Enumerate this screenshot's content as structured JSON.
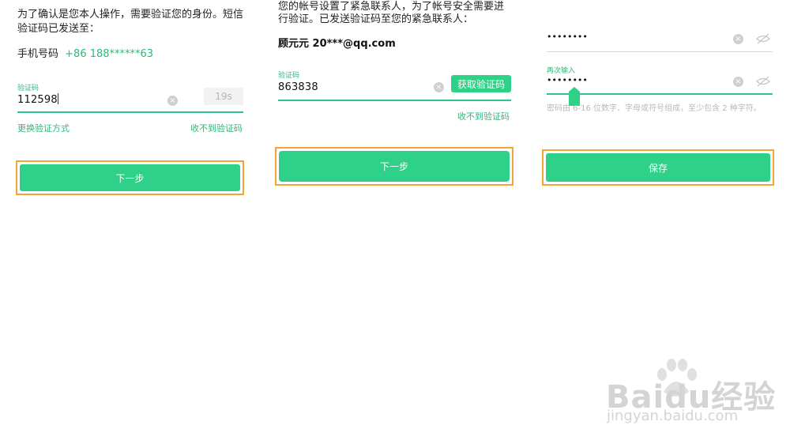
{
  "panel1": {
    "intro": "为了确认是您本人操作，需要验证您的身份。短信验证码已发送至：",
    "phone_label": "手机号码",
    "phone_number": "+86 188******63",
    "code_label": "验证码",
    "code_value": "112598",
    "countdown": "19s",
    "switch_method": "更换验证方式",
    "no_code": "收不到验证码",
    "next": "下一步"
  },
  "panel2": {
    "intro_line1": "您的帐号设置了紧急联系人，为了帐号安全需要进",
    "intro_line2": "行验证。已发送验证码至您的紧急联系人：",
    "contact": "顾元元 20***@qq.com",
    "code_label": "验证码",
    "code_value": "863838",
    "get_code": "获取验证码",
    "no_code": "收不到验证码",
    "next": "下一步"
  },
  "panel3": {
    "password_dots": "••••••••",
    "confirm_label": "再次输入",
    "confirm_dots": "••••••••",
    "hint": "密码由 6-16 位数字、字母或符号组成，至少包含 2 种字符。",
    "save": "保存"
  },
  "watermark": {
    "brand": "Baidu经验",
    "url": "jingyan.baidu.com"
  },
  "colors": {
    "accent": "#2fd088",
    "frame": "#f1a532"
  }
}
